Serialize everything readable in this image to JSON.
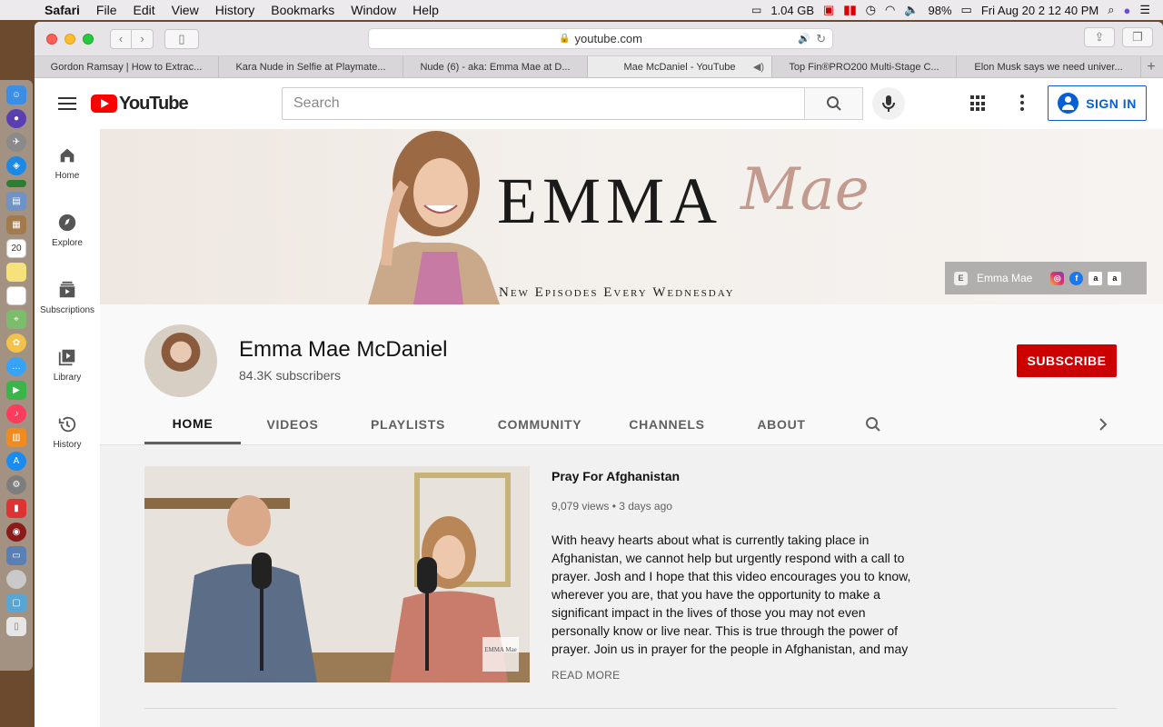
{
  "menubar": {
    "app": "Safari",
    "items": [
      "File",
      "Edit",
      "View",
      "History",
      "Bookmarks",
      "Window",
      "Help"
    ],
    "memory": "1.04 GB",
    "battery": "98%",
    "clock": "Fri Aug 20  2 12 40 PM"
  },
  "browser": {
    "url": "youtube.com",
    "tabs": [
      {
        "label": "Gordon Ramsay | How to Extrac..."
      },
      {
        "label": "Kara Nude in Selfie at Playmate..."
      },
      {
        "label": "Nude (6) - aka: Emma Mae at D..."
      },
      {
        "label": "Mae McDaniel - YouTube"
      },
      {
        "label": "Top Fin®PRO200 Multi-Stage C..."
      },
      {
        "label": "Elon Musk says we need univer..."
      }
    ],
    "new_tab": "+"
  },
  "youtube": {
    "logo_text": "YouTube",
    "search_placeholder": "Search",
    "sign_in": "SIGN IN",
    "guide": [
      {
        "label": "Home",
        "icon": "home-icon"
      },
      {
        "label": "Explore",
        "icon": "compass-icon"
      },
      {
        "label": "Subscriptions",
        "icon": "subscriptions-icon"
      },
      {
        "label": "Library",
        "icon": "library-icon"
      },
      {
        "label": "History",
        "icon": "history-icon"
      }
    ],
    "banner": {
      "brand": "EMMA",
      "brand_script": "Mae",
      "tagline": "New Episodes Every Wednesday",
      "link_name": "Emma Mae"
    },
    "channel": {
      "name": "Emma Mae McDaniel",
      "subscribers": "84.3K subscribers",
      "subscribe": "SUBSCRIBE",
      "tabs": [
        "HOME",
        "VIDEOS",
        "PLAYLISTS",
        "COMMUNITY",
        "CHANNELS",
        "ABOUT"
      ]
    },
    "featured": {
      "title": "Pray For Afghanistan",
      "meta": "9,079 views • 3 days ago",
      "description": "With heavy hearts about what is currently taking place in Afghanistan, we cannot help but urgently respond with a call to prayer. Josh and I hope that this video encourages you to know, wherever you are, that you have the opportunity to make a significant impact in the lives of those you may not even personally know or live near. This is true through the power of prayer. Join us in prayer for the people in Afghanistan, and may this not be a one time thing but a new normal for each of",
      "read_more": "READ MORE",
      "watermark": "EMMA Mae"
    }
  }
}
